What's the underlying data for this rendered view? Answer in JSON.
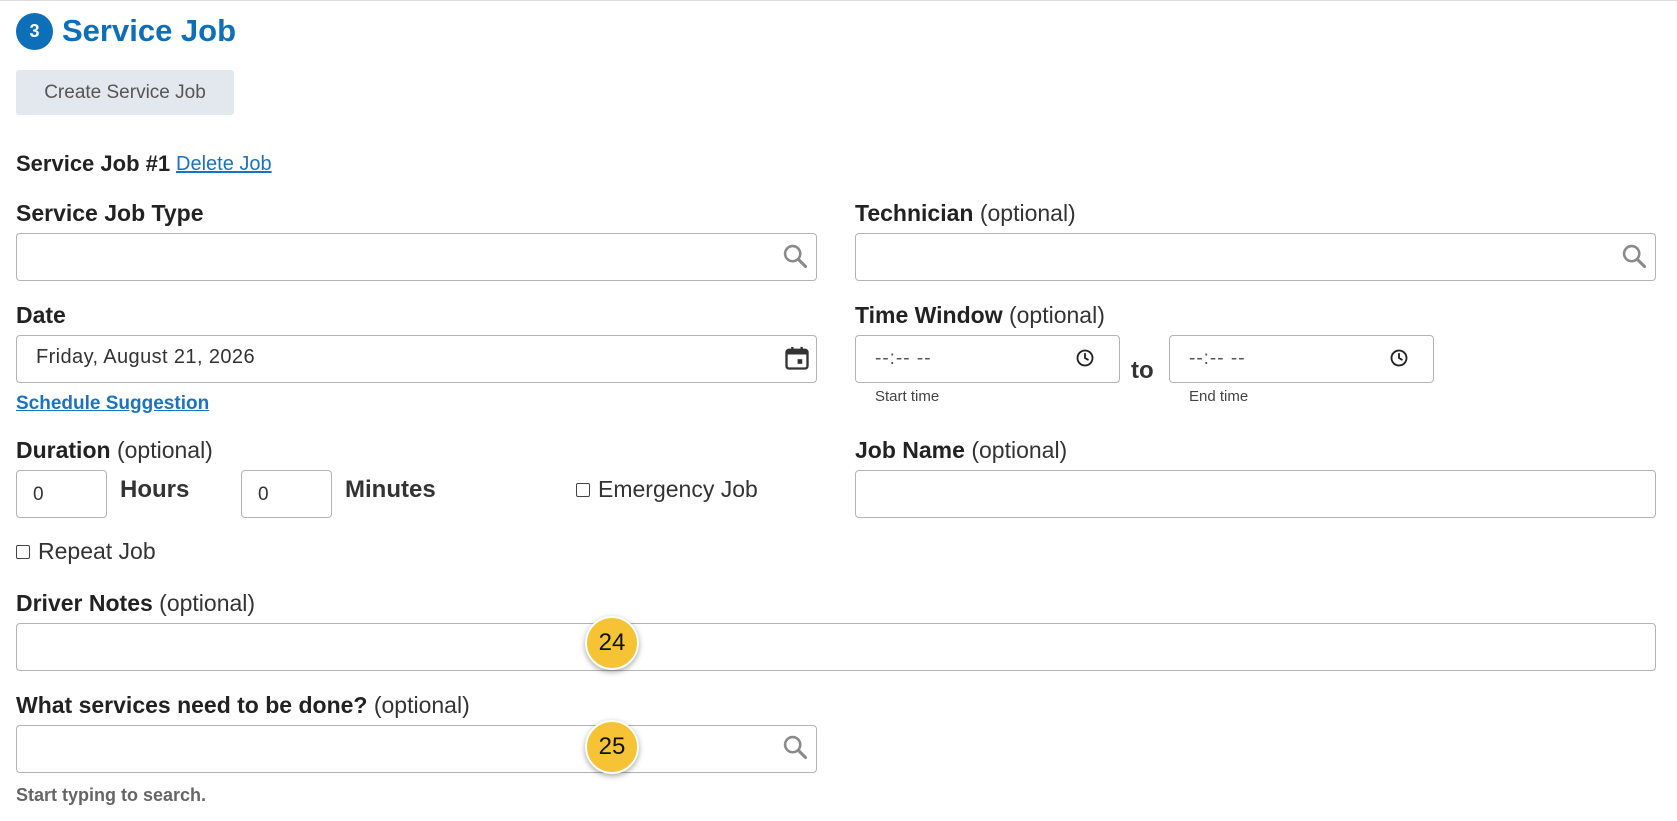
{
  "section": {
    "step_number": "3",
    "title": "Service Job"
  },
  "create_button": "Create Service Job",
  "job": {
    "heading": "Service Job #1",
    "delete_label": "Delete Job"
  },
  "service_job_type": {
    "label": "Service Job Type",
    "value": ""
  },
  "technician": {
    "label": "Technician",
    "optional": "(optional)",
    "value": ""
  },
  "date": {
    "label": "Date",
    "value": "Friday, August 21, 2026",
    "schedule_link": "Schedule Suggestion"
  },
  "time_window": {
    "label": "Time Window",
    "optional": "(optional)",
    "start_value": "--:-- --",
    "start_caption": "Start time",
    "connector": "to",
    "end_value": "--:-- --",
    "end_caption": "End time"
  },
  "duration": {
    "label": "Duration",
    "optional": "(optional)",
    "hours_value": "0",
    "hours_label": "Hours",
    "minutes_value": "0",
    "minutes_label": "Minutes"
  },
  "emergency": {
    "label": "Emergency Job",
    "checked": false
  },
  "job_name": {
    "label": "Job Name",
    "optional": "(optional)",
    "value": ""
  },
  "repeat": {
    "label": "Repeat Job",
    "checked": false
  },
  "driver_notes": {
    "label": "Driver Notes",
    "optional": "(optional)",
    "value": ""
  },
  "services": {
    "label": "What services need to be done?",
    "optional": "(optional)",
    "value": "",
    "hint": "Start typing to search."
  },
  "annotations": {
    "badge_a": "24",
    "badge_b": "25"
  },
  "colors": {
    "accent": "#0d6fb8",
    "link": "#1a73c2",
    "badge": "#f6c335",
    "button_bg": "#e3e7ee"
  },
  "icons": {
    "search": "search-icon",
    "calendar": "calendar-icon",
    "clock": "clock-icon"
  }
}
